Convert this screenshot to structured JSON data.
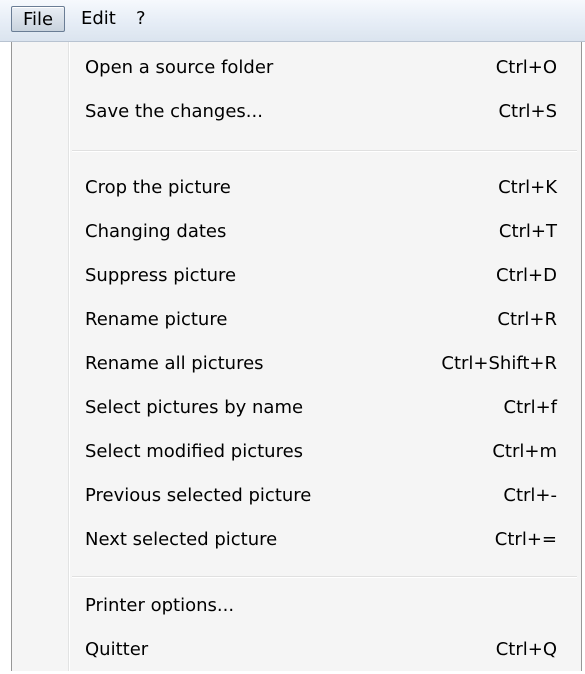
{
  "menubar": {
    "file": "File",
    "edit": "Edit",
    "help": "?"
  },
  "menu": {
    "items": [
      {
        "label": "Open a source folder",
        "shortcut": "Ctrl+O"
      },
      {
        "label": "Save the changes...",
        "shortcut": "Ctrl+S"
      },
      {
        "label": "Crop the picture",
        "shortcut": "Ctrl+K"
      },
      {
        "label": "Changing dates",
        "shortcut": "Ctrl+T"
      },
      {
        "label": "Suppress picture",
        "shortcut": "Ctrl+D"
      },
      {
        "label": "Rename picture",
        "shortcut": "Ctrl+R"
      },
      {
        "label": "Rename all pictures",
        "shortcut": "Ctrl+Shift+R"
      },
      {
        "label": "Select pictures by name",
        "shortcut": "Ctrl+f"
      },
      {
        "label": "Select modified pictures",
        "shortcut": "Ctrl+m"
      },
      {
        "label": "Previous selected picture",
        "shortcut": "Ctrl+-"
      },
      {
        "label": "Next selected picture",
        "shortcut": "Ctrl+="
      },
      {
        "label": "Printer options...",
        "shortcut": ""
      },
      {
        "label": "Quitter",
        "shortcut": "Ctrl+Q"
      }
    ]
  }
}
